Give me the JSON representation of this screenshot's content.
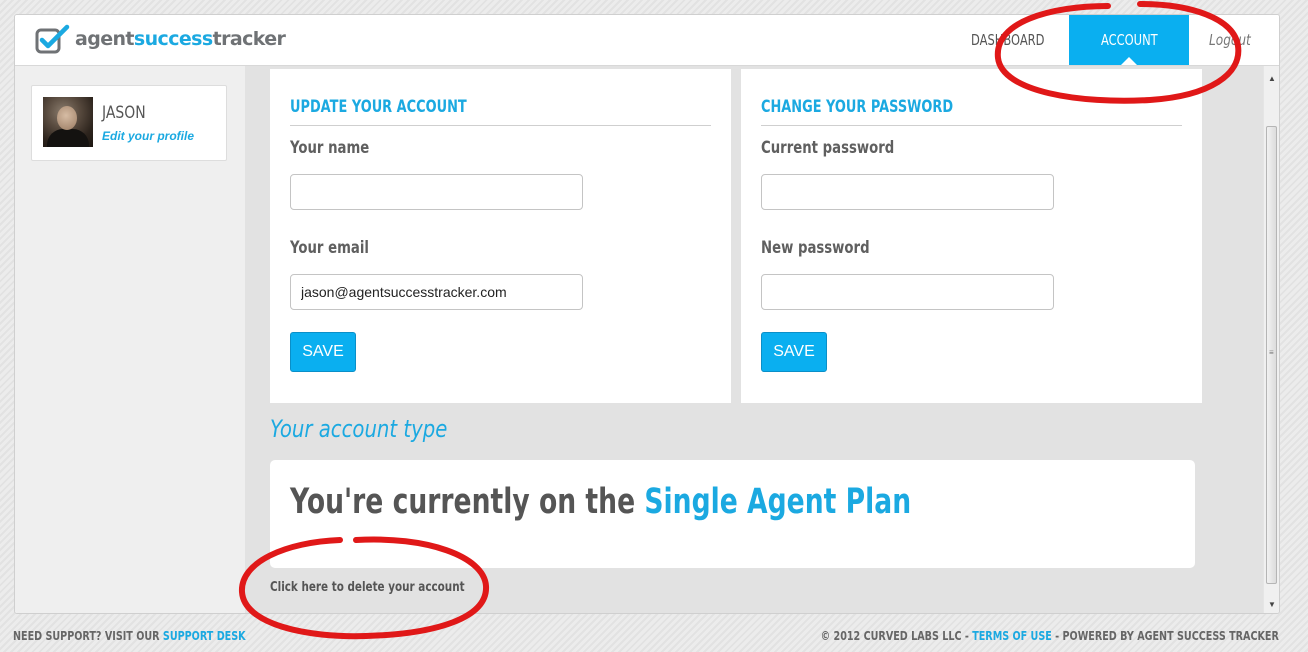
{
  "header": {
    "logo": {
      "part1": "agent",
      "part2": "success",
      "part3": "tracker"
    },
    "nav": {
      "dashboard": "DASHBOARD",
      "account": "ACCOUNT",
      "logout": "Logout"
    }
  },
  "sidebar": {
    "profile": {
      "name": "JASON",
      "edit_link": "Edit your profile"
    }
  },
  "update_account": {
    "title": "UPDATE YOUR ACCOUNT",
    "name_label": "Your name",
    "name_value": "",
    "email_label": "Your email",
    "email_value": "jason@agentsuccesstracker.com",
    "save_label": "SAVE"
  },
  "change_password": {
    "title": "CHANGE YOUR PASSWORD",
    "current_label": "Current password",
    "current_value": "",
    "new_label": "New password",
    "new_value": "",
    "save_label": "SAVE"
  },
  "account_type": {
    "heading": "Your account type",
    "plan_prefix": "You're currently on the ",
    "plan_name": "Single Agent Plan",
    "delete_link": "Click here to delete your account"
  },
  "footer": {
    "support_prefix": "NEED SUPPORT? VISIT OUR ",
    "support_link": "SUPPORT DESK",
    "copyright": "© 2012 CURVED LABS LLC - ",
    "terms_link": "TERMS OF USE",
    "powered_by": " - POWERED BY AGENT SUCCESS TRACKER"
  },
  "colors": {
    "accent": "#0aaff0",
    "annotation": "#e01818",
    "main_bg": "#e2e2e2",
    "sidebar_bg": "#efefef"
  },
  "icons": {
    "logo": "checkbox-check-icon",
    "scroll_up": "arrow-up-icon",
    "scroll_down": "arrow-down-icon"
  }
}
